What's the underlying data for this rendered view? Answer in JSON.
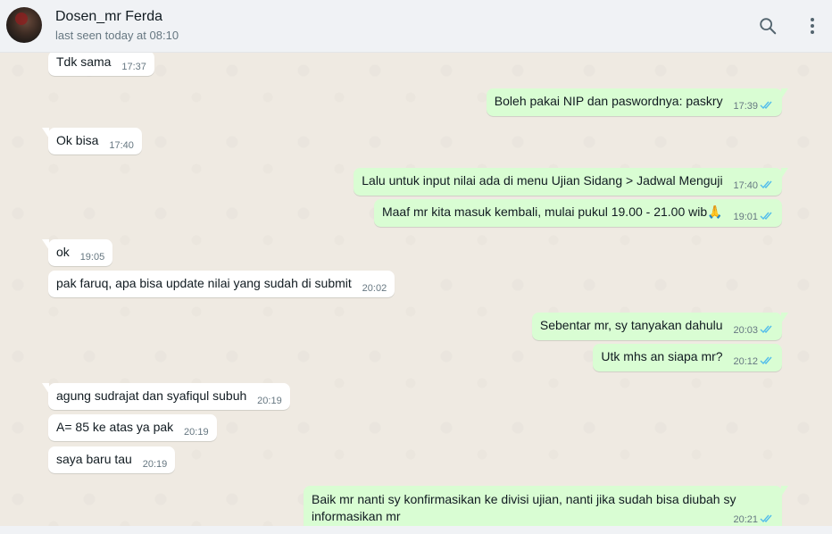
{
  "contact": {
    "name": "Dosen_mr Ferda",
    "status": "last seen today at 08:10"
  },
  "header_icons": [
    "search-icon",
    "menu-icon"
  ],
  "colors": {
    "incoming": "#ffffff",
    "outgoing": "#d9fdd3",
    "read_ticks": "#53bdeb",
    "background": "#efeae2"
  },
  "messages": [
    {
      "dir": "in",
      "text": "Tdk sama",
      "time": "17:37"
    },
    {
      "dir": "out",
      "text": "Boleh pakai NIP dan paswordnya: paskry",
      "time": "17:39"
    },
    {
      "dir": "in",
      "text": "Ok bisa",
      "time": "17:40"
    },
    {
      "dir": "out",
      "text": "Lalu untuk input nilai ada di menu Ujian Sidang > Jadwal Menguji",
      "time": "17:40"
    },
    {
      "dir": "out",
      "text": "Maaf mr kita masuk kembali, mulai pukul 19.00 - 21.00 wib🙏",
      "time": "19:01"
    },
    {
      "dir": "in",
      "text": "ok",
      "time": "19:05"
    },
    {
      "dir": "in",
      "text": "pak faruq, apa bisa update nilai yang sudah di submit",
      "time": "20:02"
    },
    {
      "dir": "out",
      "text": "Sebentar mr, sy tanyakan dahulu",
      "time": "20:03"
    },
    {
      "dir": "out",
      "text": "Utk mhs an siapa mr?",
      "time": "20:12"
    },
    {
      "dir": "in",
      "text": "agung sudrajat dan syafiqul subuh",
      "time": "20:19"
    },
    {
      "dir": "in",
      "text": "A= 85 ke atas ya pak",
      "time": "20:19"
    },
    {
      "dir": "in",
      "text": "saya baru tau",
      "time": "20:19"
    },
    {
      "dir": "out",
      "text": "Baik mr nanti sy konfirmasikan ke divisi ujian, nanti jika sudah bisa diubah sy informasikan mr",
      "time": "20:21"
    }
  ]
}
